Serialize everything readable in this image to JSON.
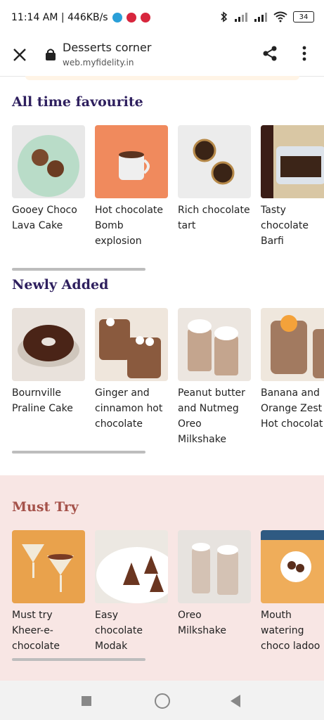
{
  "status": {
    "time_speed": "11:14 AM | 446KB/s",
    "battery": "34"
  },
  "toolbar": {
    "title": "Desserts corner",
    "url": "web.myfidelity.in"
  },
  "sections": {
    "favourite": {
      "title": "All time favourite",
      "title_color": "#2e1f5e",
      "items": [
        {
          "label": "Gooey Choco Lava Cake"
        },
        {
          "label": "Hot chocolate Bomb explosion"
        },
        {
          "label": "Rich chocolate tart"
        },
        {
          "label": "Tasty chocolate Barfi"
        }
      ]
    },
    "newly": {
      "title": "Newly Added",
      "title_color": "#2e1f5e",
      "items": [
        {
          "label": "Bournville Praline Cake"
        },
        {
          "label": "Ginger and cinnamon hot chocolate"
        },
        {
          "label": "Peanut butter and Nutmeg Oreo Milkshake"
        },
        {
          "label": "Banana and Orange Zest Hot chocolat"
        }
      ]
    },
    "must": {
      "title": "Must Try",
      "title_color": "#a5524a",
      "items": [
        {
          "label": "Must try Kheer-e-chocolate"
        },
        {
          "label": "Easy chocolate Modak"
        },
        {
          "label": "Oreo Milkshake"
        },
        {
          "label": "Mouth watering choco ladoo"
        }
      ]
    }
  },
  "colors": {
    "must_try_background": "#f8e6e4",
    "scrollbar": "#bdbdbd"
  }
}
